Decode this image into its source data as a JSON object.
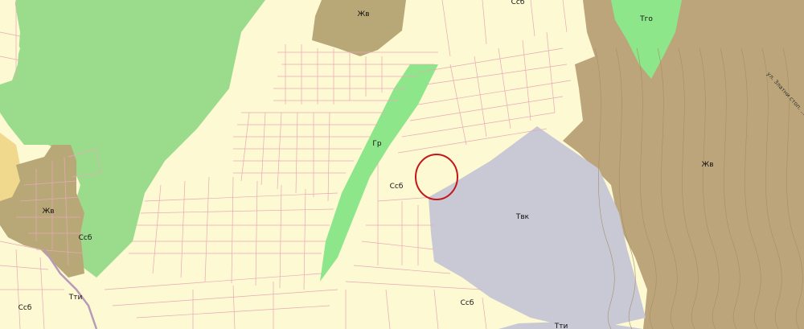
{
  "colors": {
    "residential_ccb": "#fdf9d2",
    "forest_green": "#9bdc8c",
    "park_light_green": "#8ee68a",
    "residential_zhv": "#b8a878",
    "terrain_brown": "#bca57a",
    "industrial_tvk": "#c9c9d6",
    "yellow_zone": "#f0d98c",
    "parcel_lines": "#e8a8b8",
    "marker_circle": "#c4161c"
  },
  "labels": {
    "zhv_top": "Жв",
    "ccb_top": "Ссб",
    "tgo": "Тго",
    "gr": "Гр",
    "ccb_center": "Ссб",
    "zhv_left": "Жв",
    "ccb_left": "Ссб",
    "tvk": "Твк",
    "zhv_right": "Жв",
    "ccb_bottom_left": "Ссб",
    "tti_bottom": "Тти",
    "ccb_bottom": "Ссб",
    "tti_bottom_right": "Тти"
  },
  "road_label": "ул. Златни стоп. ..."
}
